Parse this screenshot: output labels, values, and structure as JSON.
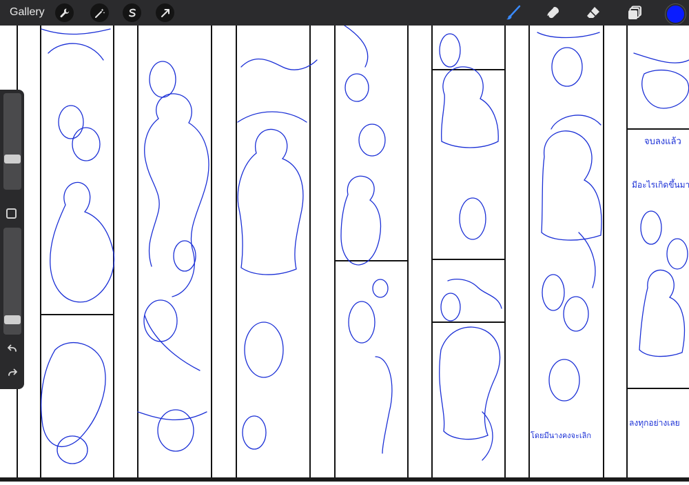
{
  "topbar": {
    "gallery_label": "Gallery",
    "left_tools": [
      "wrench-icon",
      "magic-wand-icon",
      "selection-s-icon",
      "transform-arrow-icon"
    ],
    "right_tools": [
      "brush-icon",
      "smudge-icon",
      "eraser-icon",
      "layers-icon"
    ],
    "current_color": "#0a1cff"
  },
  "sidebar": {
    "brush_size_level": 0.3,
    "opacity_level": 0.1
  },
  "canvas": {
    "ink_color": "#1a2fd6",
    "captions": {
      "p10_top": "จบลงแล้ว",
      "p10_mid": "มีอะไรเกิดขึ้นมาบ้าง",
      "p10_bottom": "ลงทุกอย่างเลย",
      "p9_bottom": "โดยมีนางคงจะเลิก"
    }
  }
}
